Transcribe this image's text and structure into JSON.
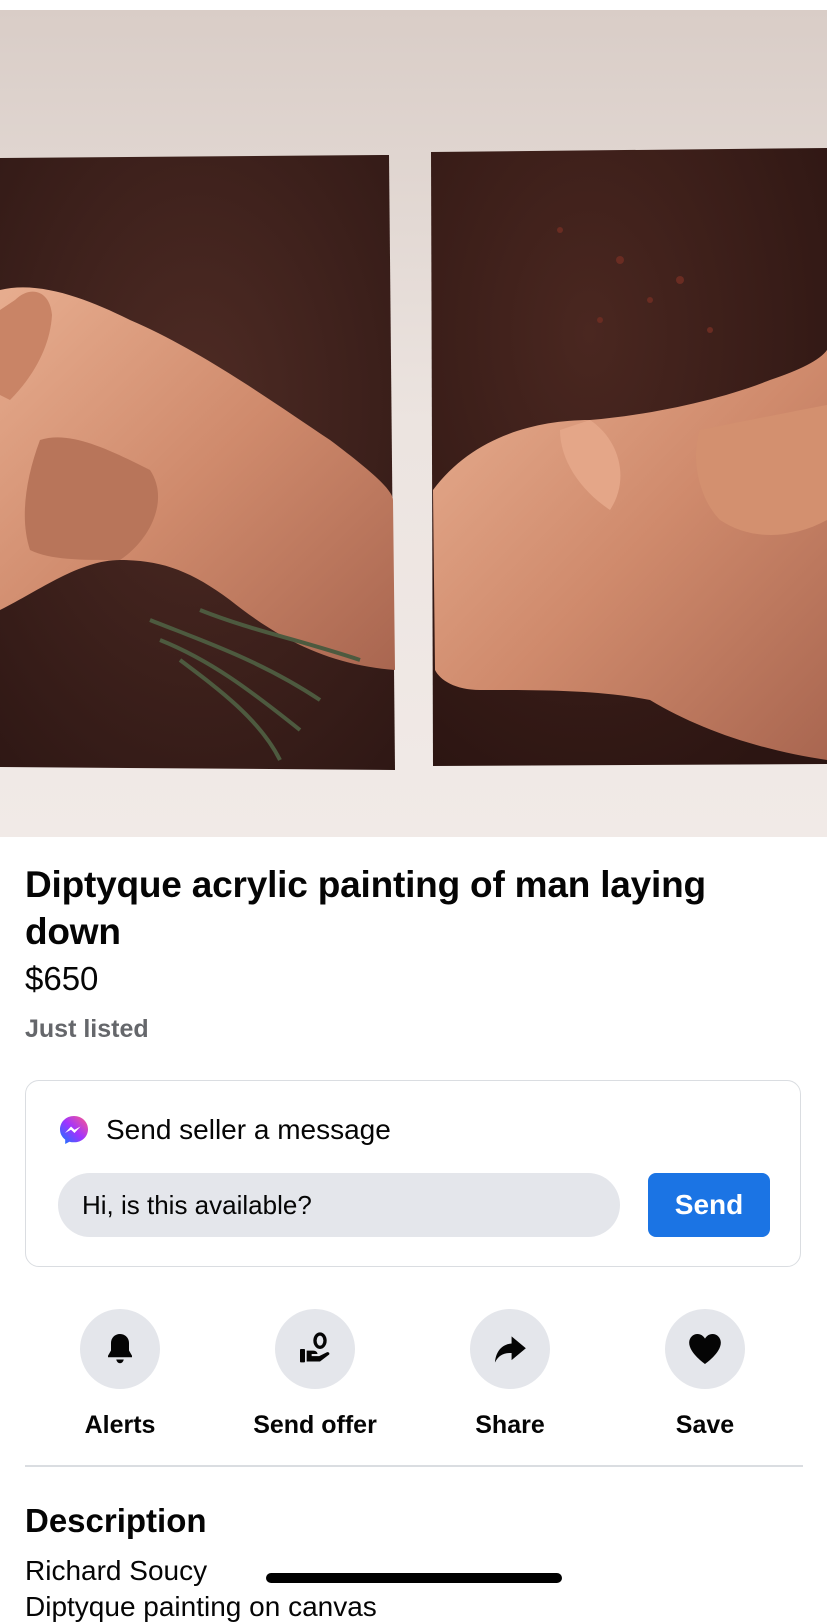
{
  "listing": {
    "title": "Diptyque acrylic painting of man laying down",
    "price": "$650",
    "status": "Just listed"
  },
  "message_card": {
    "heading": "Send seller a message",
    "input_value": "Hi, is this available?",
    "send_label": "Send",
    "icon": "messenger-icon"
  },
  "actions": [
    {
      "label": "Alerts",
      "icon": "bell-icon"
    },
    {
      "label": "Send offer",
      "icon": "offer-icon"
    },
    {
      "label": "Share",
      "icon": "share-icon"
    },
    {
      "label": "Save",
      "icon": "heart-icon"
    }
  ],
  "description": {
    "heading": "Description",
    "line1": "Richard Soucy",
    "line2": "Diptyque painting on canvas"
  },
  "colors": {
    "accent": "#1b74e4",
    "secondary_text": "#65676b",
    "button_gray": "#e4e6eb"
  }
}
